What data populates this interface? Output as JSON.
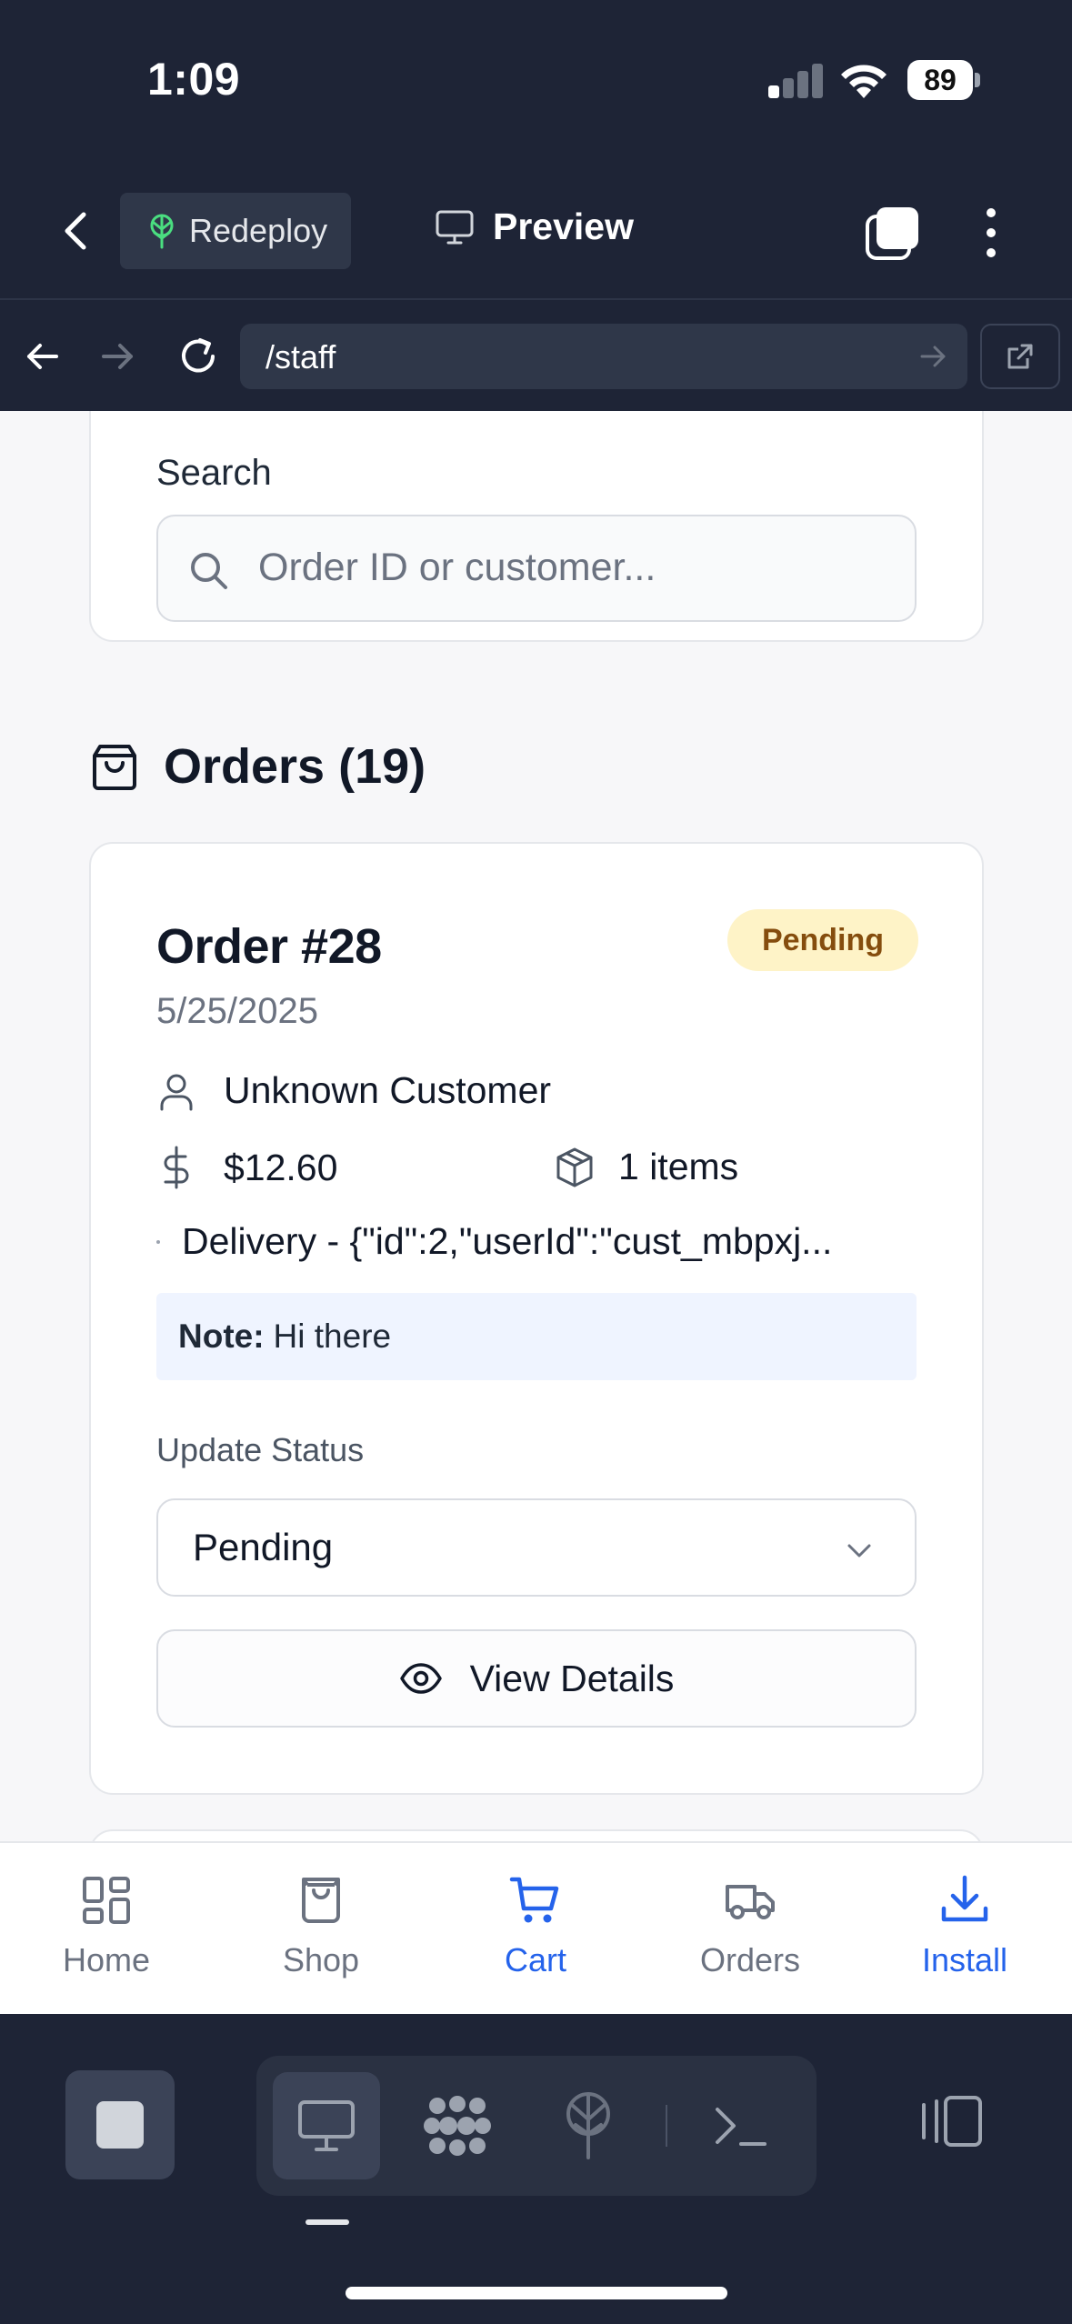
{
  "status_bar": {
    "time": "1:09",
    "battery": "89"
  },
  "app_bar": {
    "redeploy_label": "Redeploy",
    "preview_label": "Preview"
  },
  "browser": {
    "url": "/staff"
  },
  "search": {
    "label": "Search",
    "placeholder": "Order ID or customer..."
  },
  "orders": {
    "heading": "Orders (19)"
  },
  "order": {
    "title": "Order #28",
    "status_badge": "Pending",
    "date": "5/25/2025",
    "customer": "Unknown Customer",
    "total": "$12.60",
    "items": "1 items",
    "delivery": "Delivery - {\"id\":2,\"userId\":\"cust_mbpxj...",
    "note_label": "Note:",
    "note_text": "Hi there",
    "update_status_label": "Update Status",
    "selected_status": "Pending",
    "view_details_label": "View Details"
  },
  "tab_bar": {
    "items": [
      {
        "label": "Home",
        "icon": "grid-icon",
        "state": "default"
      },
      {
        "label": "Shop",
        "icon": "shopping-bag-icon",
        "state": "default"
      },
      {
        "label": "Cart",
        "icon": "cart-icon",
        "state": "active"
      },
      {
        "label": "Orders",
        "icon": "truck-icon",
        "state": "default"
      },
      {
        "label": "Install",
        "icon": "download-icon",
        "state": "accent"
      }
    ]
  },
  "colors": {
    "chrome_bg": "#1e2436",
    "accent": "#2563eb",
    "badge_bg": "#fef3c7",
    "badge_text": "#854d0e",
    "note_bg": "#eff4ff"
  }
}
